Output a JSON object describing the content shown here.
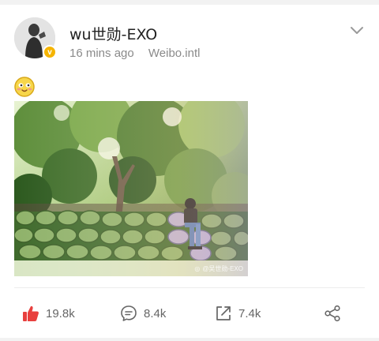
{
  "post": {
    "username": "wu世勋-EXO",
    "time": "16 mins ago",
    "source": "Weibo.intl",
    "verified_badge": "v",
    "photo_watermark": "@吴世勋-EXO"
  },
  "actions": {
    "likes": "19.8k",
    "comments": "8.4k",
    "reposts": "7.4k"
  },
  "colors": {
    "like_red": "#e8403e",
    "badge_gold": "#f5b400",
    "meta_gray": "#8a8a8a"
  },
  "icons": [
    "avatar",
    "verified-badge-icon",
    "chevron-down-icon",
    "emoji-icon",
    "like-icon",
    "comment-icon",
    "repost-icon",
    "share-icon"
  ]
}
